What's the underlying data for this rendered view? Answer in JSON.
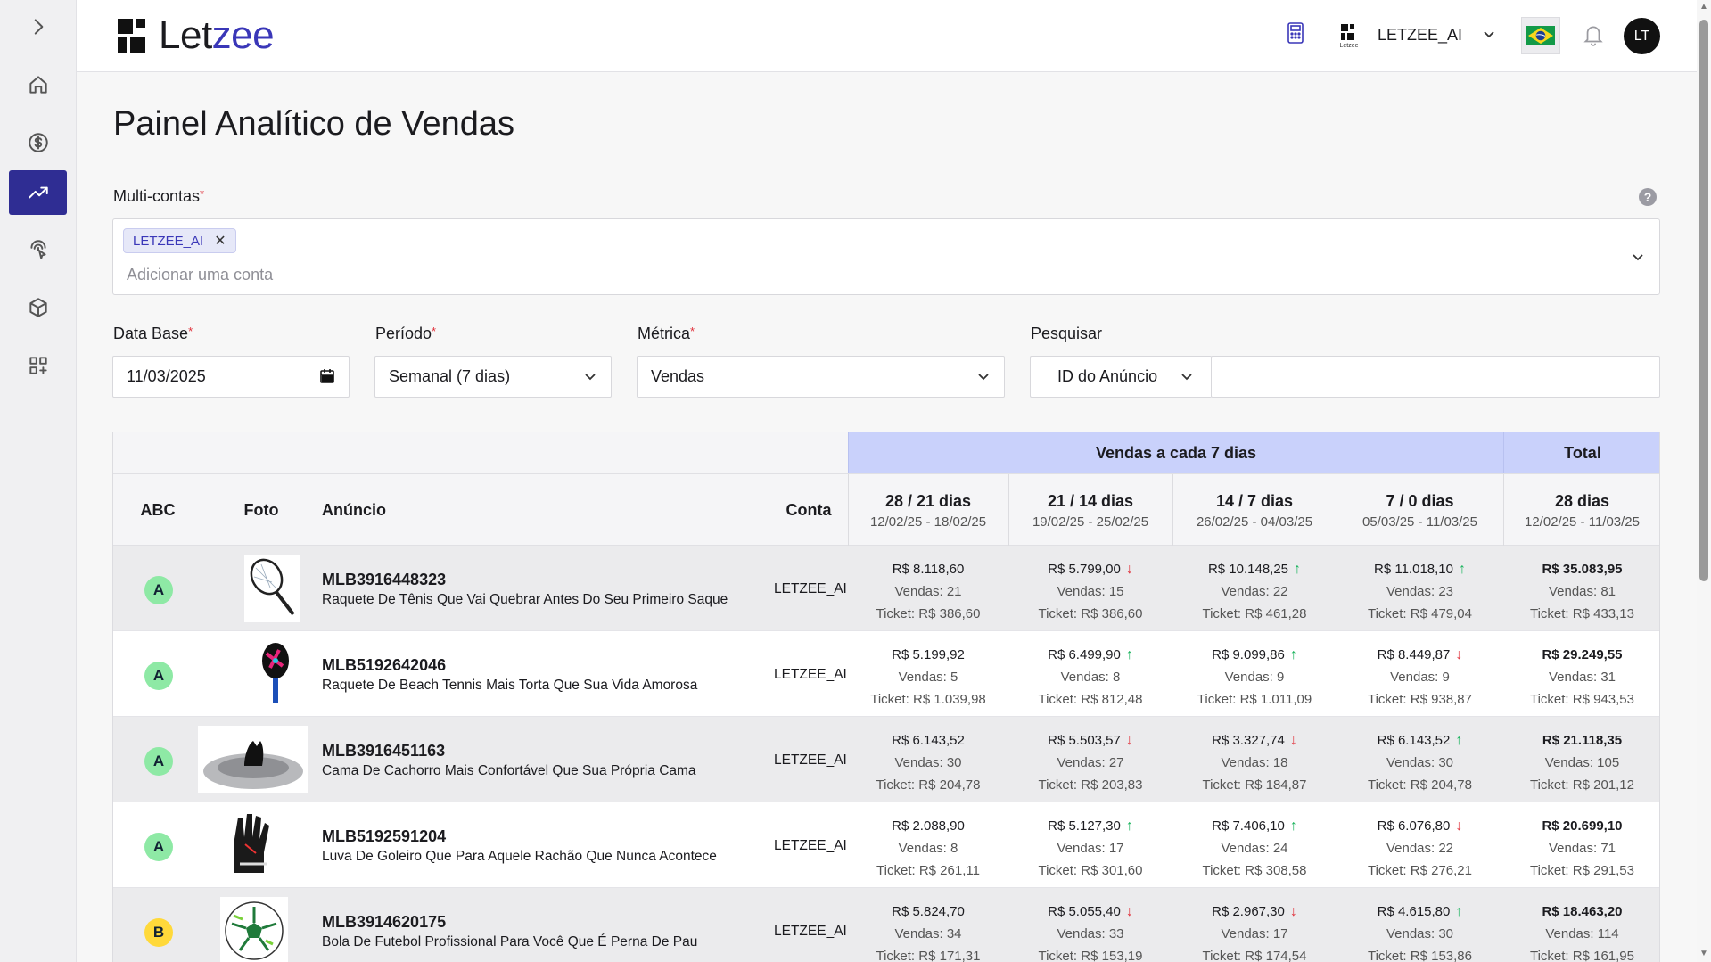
{
  "header": {
    "logo_text_a": "Let",
    "logo_text_b": "zee",
    "account_logo_caption": "Letzee",
    "account_name": "LETZEE_AI",
    "avatar_initials": "LT"
  },
  "sidebar": {
    "items": [
      {
        "icon": "chevron-right-icon"
      },
      {
        "icon": "home-icon"
      },
      {
        "icon": "dollar-icon"
      },
      {
        "icon": "trending-up-icon",
        "active": true
      },
      {
        "icon": "fingerprint-pointer-icon"
      },
      {
        "icon": "box-icon"
      },
      {
        "icon": "apps-add-icon"
      }
    ]
  },
  "page": {
    "title": "Painel Analítico de Vendas"
  },
  "filters": {
    "multi_label": "Multi-contas",
    "required_mark": "*",
    "multi_chip": "LETZEE_AI",
    "multi_chip_remove": "✕",
    "multi_placeholder": "Adicionar uma conta",
    "data_base_label": "Data Base",
    "data_base_value": "11/03/2025",
    "periodo_label": "Período",
    "periodo_value": "Semanal (7 dias)",
    "metrica_label": "Métrica",
    "metrica_value": "Vendas",
    "pesquisar_label": "Pesquisar",
    "pesquisar_type": "ID do Anúncio",
    "pesquisar_value": ""
  },
  "table": {
    "group_header": "Vendas a cada 7 dias",
    "total_header": "Total",
    "col_abc": "ABC",
    "col_foto": "Foto",
    "col_anuncio": "Anúncio",
    "col_conta": "Conta",
    "periods": [
      {
        "label": "28 / 21 dias",
        "range": "12/02/25 - 18/02/25"
      },
      {
        "label": "21 / 14 dias",
        "range": "19/02/25 - 25/02/25"
      },
      {
        "label": "14 / 7 dias",
        "range": "26/02/25 - 04/03/25"
      },
      {
        "label": "7 / 0 dias",
        "range": "05/03/25 - 11/03/25"
      }
    ],
    "total_period": {
      "label": "28 dias",
      "range": "12/02/25 - 11/03/25"
    },
    "rows": [
      {
        "abc": "A",
        "photo": "tennis-racket",
        "id": "MLB3916448323",
        "title": "Raquete De Tênis Que Vai Quebrar Antes Do Seu Primeiro Saque",
        "conta": "LETZEE_AI",
        "cells": [
          {
            "money": "R$ 8.118,60",
            "vendas": "Vendas: 21",
            "ticket": "Ticket: R$ 386,60",
            "trend": ""
          },
          {
            "money": "R$ 5.799,00",
            "vendas": "Vendas: 15",
            "ticket": "Ticket: R$ 386,60",
            "trend": "down"
          },
          {
            "money": "R$ 10.148,25",
            "vendas": "Vendas: 22",
            "ticket": "Ticket: R$ 461,28",
            "trend": "up"
          },
          {
            "money": "R$ 11.018,10",
            "vendas": "Vendas: 23",
            "ticket": "Ticket: R$ 479,04",
            "trend": "up"
          }
        ],
        "total": {
          "money": "R$ 35.083,95",
          "vendas": "Vendas: 81",
          "ticket": "Ticket: R$ 433,13"
        }
      },
      {
        "abc": "A",
        "photo": "beach-tennis-racket",
        "id": "MLB5192642046",
        "title": "Raquete De Beach Tennis Mais Torta Que Sua Vida Amorosa",
        "conta": "LETZEE_AI",
        "cells": [
          {
            "money": "R$ 5.199,92",
            "vendas": "Vendas: 5",
            "ticket": "Ticket: R$ 1.039,98",
            "trend": ""
          },
          {
            "money": "R$ 6.499,90",
            "vendas": "Vendas: 8",
            "ticket": "Ticket: R$ 812,48",
            "trend": "up"
          },
          {
            "money": "R$ 9.099,86",
            "vendas": "Vendas: 9",
            "ticket": "Ticket: R$ 1.011,09",
            "trend": "up"
          },
          {
            "money": "R$ 8.449,87",
            "vendas": "Vendas: 9",
            "ticket": "Ticket: R$ 938,87",
            "trend": "down"
          }
        ],
        "total": {
          "money": "R$ 29.249,55",
          "vendas": "Vendas: 31",
          "ticket": "Ticket: R$ 943,53"
        }
      },
      {
        "abc": "A",
        "photo": "dog-bed",
        "id": "MLB3916451163",
        "title": "Cama De Cachorro Mais Confortável Que Sua Própria Cama",
        "conta": "LETZEE_AI",
        "cells": [
          {
            "money": "R$ 6.143,52",
            "vendas": "Vendas: 30",
            "ticket": "Ticket: R$ 204,78",
            "trend": ""
          },
          {
            "money": "R$ 5.503,57",
            "vendas": "Vendas: 27",
            "ticket": "Ticket: R$ 203,83",
            "trend": "down"
          },
          {
            "money": "R$ 3.327,74",
            "vendas": "Vendas: 18",
            "ticket": "Ticket: R$ 184,87",
            "trend": "down"
          },
          {
            "money": "R$ 6.143,52",
            "vendas": "Vendas: 30",
            "ticket": "Ticket: R$ 204,78",
            "trend": "up"
          }
        ],
        "total": {
          "money": "R$ 21.118,35",
          "vendas": "Vendas: 105",
          "ticket": "Ticket: R$ 201,12"
        }
      },
      {
        "abc": "A",
        "photo": "goalkeeper-glove",
        "id": "MLB5192591204",
        "title": "Luva De Goleiro Que Para Aquele Rachão Que Nunca Acontece",
        "conta": "LETZEE_AI",
        "cells": [
          {
            "money": "R$ 2.088,90",
            "vendas": "Vendas: 8",
            "ticket": "Ticket: R$ 261,11",
            "trend": ""
          },
          {
            "money": "R$ 5.127,30",
            "vendas": "Vendas: 17",
            "ticket": "Ticket: R$ 301,60",
            "trend": "up"
          },
          {
            "money": "R$ 7.406,10",
            "vendas": "Vendas: 24",
            "ticket": "Ticket: R$ 308,58",
            "trend": "up"
          },
          {
            "money": "R$ 6.076,80",
            "vendas": "Vendas: 22",
            "ticket": "Ticket: R$ 276,21",
            "trend": "down"
          }
        ],
        "total": {
          "money": "R$ 20.699,10",
          "vendas": "Vendas: 71",
          "ticket": "Ticket: R$ 291,53"
        }
      },
      {
        "abc": "B",
        "photo": "soccer-ball",
        "id": "MLB3914620175",
        "title": "Bola De Futebol Profissional Para Você Que É Perna De Pau",
        "conta": "LETZEE_AI",
        "cells": [
          {
            "money": "R$ 5.824,70",
            "vendas": "Vendas: 34",
            "ticket": "Ticket: R$ 171,31",
            "trend": ""
          },
          {
            "money": "R$ 5.055,40",
            "vendas": "Vendas: 33",
            "ticket": "Ticket: R$ 153,19",
            "trend": "down"
          },
          {
            "money": "R$ 2.967,30",
            "vendas": "Vendas: 17",
            "ticket": "Ticket: R$ 174,54",
            "trend": "down"
          },
          {
            "money": "R$ 4.615,80",
            "vendas": "Vendas: 30",
            "ticket": "Ticket: R$ 153,86",
            "trend": "up"
          }
        ],
        "total": {
          "money": "R$ 18.463,20",
          "vendas": "Vendas: 114",
          "ticket": "Ticket: R$ 161,95"
        }
      }
    ]
  },
  "colors": {
    "accent": "#2f2d93",
    "brand_zee": "#3a37b8",
    "header_band": "#c9d1fb",
    "abc_a": "#8ee9a5",
    "abc_b": "#ffd93a",
    "trend_up": "#19b35c",
    "trend_down": "#e0303a"
  }
}
